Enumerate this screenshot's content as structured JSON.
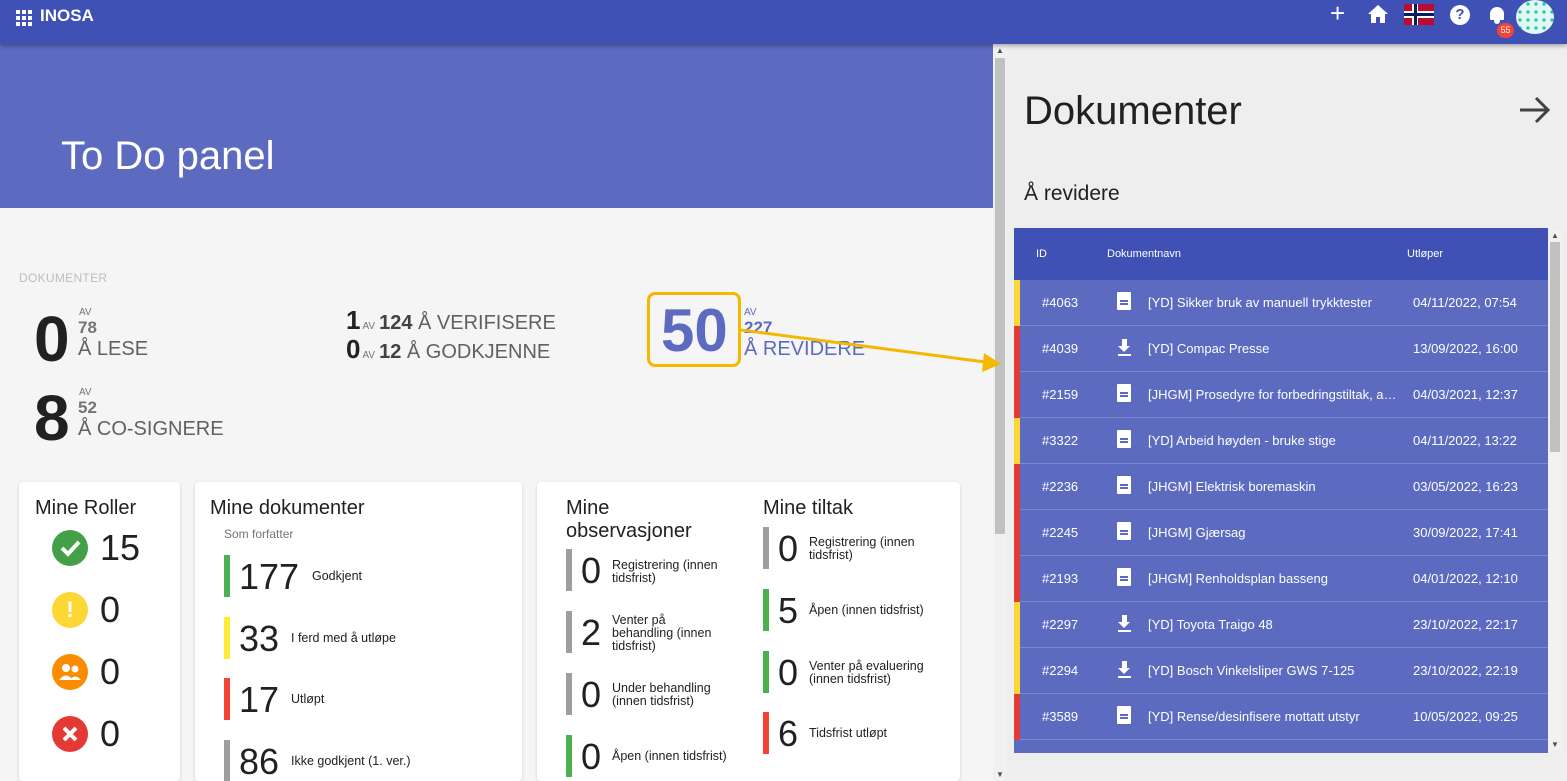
{
  "app": {
    "brand": "INOSA",
    "notifications": "55"
  },
  "hero": {
    "title": "To Do panel"
  },
  "documents_summary": {
    "section_label": "DOKUMENTER",
    "av": "AV",
    "lese": {
      "count": "0",
      "of": "78",
      "label": "Å LESE"
    },
    "cosignere": {
      "count": "8",
      "of": "52",
      "label": "Å CO-SIGNERE"
    },
    "verifisere": {
      "count": "1",
      "of": "124",
      "label": "Å VERIFISERE"
    },
    "godkjenne": {
      "count": "0",
      "of": "12",
      "label": "Å GODKJENNE"
    },
    "revidere": {
      "count": "50",
      "of": "227",
      "label": "Å REVIDERE"
    }
  },
  "roles_card": {
    "title": "Mine Roller",
    "items": [
      {
        "count": "15",
        "color": "#43a047",
        "icon": "check-icon"
      },
      {
        "count": "0",
        "color": "#fdd835",
        "icon": "exclamation-icon"
      },
      {
        "count": "0",
        "color": "#fb8c00",
        "icon": "people-icon"
      },
      {
        "count": "0",
        "color": "#e53935",
        "icon": "close-icon"
      }
    ]
  },
  "my_documents_card": {
    "title": "Mine dokumenter",
    "subtitle": "Som forfatter",
    "items": [
      {
        "count": "177",
        "label": "Godkjent",
        "color": "#4caf50"
      },
      {
        "count": "33",
        "label": "I ferd med å utløpe",
        "color": "#ffeb3b"
      },
      {
        "count": "17",
        "label": "Utløpt",
        "color": "#f44336"
      },
      {
        "count": "86",
        "label": "Ikke godkjent (1. ver.)",
        "color": "#9e9e9e"
      }
    ]
  },
  "observations_card": {
    "title_line1": "Mine",
    "title_line2": "observasjoner",
    "items": [
      {
        "count": "0",
        "label": "Registrering (innen tidsfrist)",
        "color": "#9e9e9e"
      },
      {
        "count": "2",
        "label": "Venter på behandling (innen tidsfrist)",
        "color": "#9e9e9e"
      },
      {
        "count": "0",
        "label": "Under behandling (innen tidsfrist)",
        "color": "#9e9e9e"
      },
      {
        "count": "0",
        "label": "Åpen (innen tidsfrist)",
        "color": "#4caf50"
      }
    ]
  },
  "measures_card": {
    "title": "Mine tiltak",
    "items": [
      {
        "count": "0",
        "label": "Registrering (innen tidsfrist)",
        "color": "#9e9e9e"
      },
      {
        "count": "5",
        "label": "Åpen (innen tidsfrist)",
        "color": "#4caf50"
      },
      {
        "count": "0",
        "label": "Venter på evaluering (innen tidsfrist)",
        "color": "#4caf50"
      },
      {
        "count": "6",
        "label": "Tidsfrist utløpt",
        "color": "#f44336"
      }
    ]
  },
  "panel": {
    "title": "Dokumenter",
    "subtitle": "Å revidere",
    "columns": {
      "id": "ID",
      "name": "Dokumentnavn",
      "expires": "Utløper"
    },
    "rows": [
      {
        "id": "#4063",
        "name": "[YD] Sikker bruk av manuell trykktester",
        "expires": "04/11/2022, 07:54",
        "status": "#fdd835",
        "icon": "document-icon"
      },
      {
        "id": "#4039",
        "name": "[YD] Compac Presse",
        "expires": "13/09/2022, 16:00",
        "status": "#e53935",
        "icon": "download-icon"
      },
      {
        "id": "#2159",
        "name": "[JHGM] Prosedyre for forbedringstiltak, avvik og klager",
        "expires": "04/03/2021, 12:37",
        "status": "#e53935",
        "icon": "document-icon"
      },
      {
        "id": "#3322",
        "name": "[YD] Arbeid høyden - bruke stige",
        "expires": "04/11/2022, 13:22",
        "status": "#fdd835",
        "icon": "document-icon"
      },
      {
        "id": "#2236",
        "name": "[JHGM] Elektrisk boremaskin",
        "expires": "03/05/2022, 16:23",
        "status": "#e53935",
        "icon": "document-icon"
      },
      {
        "id": "#2245",
        "name": "[JHGM] Gjærsag",
        "expires": "30/09/2022, 17:41",
        "status": "#e53935",
        "icon": "document-icon"
      },
      {
        "id": "#2193",
        "name": "[JHGM] Renholdsplan basseng",
        "expires": "04/01/2022, 12:10",
        "status": "#e53935",
        "icon": "document-icon"
      },
      {
        "id": "#2297",
        "name": "[YD] Toyota Traigo 48",
        "expires": "23/10/2022, 22:17",
        "status": "#fdd835",
        "icon": "download-icon"
      },
      {
        "id": "#2294",
        "name": "[YD] Bosch Vinkelsliper GWS 7-125",
        "expires": "23/10/2022, 22:19",
        "status": "#fdd835",
        "icon": "download-icon"
      },
      {
        "id": "#3589",
        "name": "[YD] Rense/desinfisere mottatt utstyr",
        "expires": "10/05/2022, 09:25",
        "status": "#e53935",
        "icon": "document-icon"
      }
    ]
  }
}
